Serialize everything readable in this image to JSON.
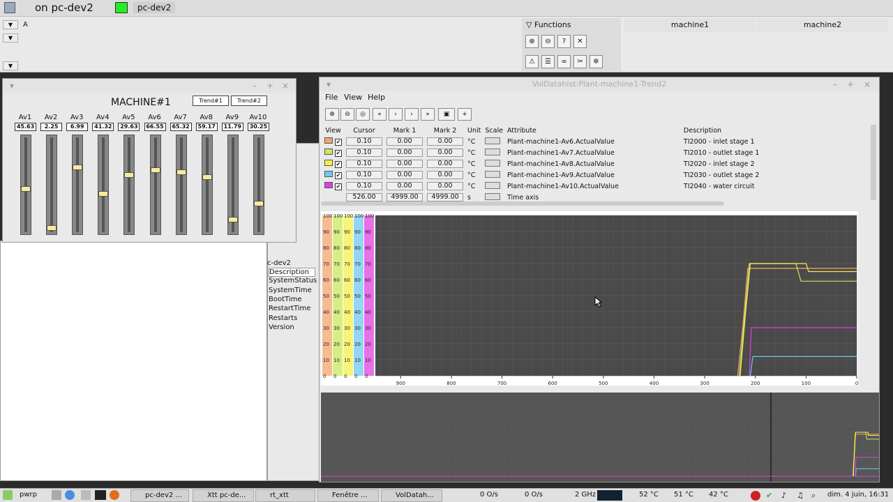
{
  "topbar": {
    "title": "on pc-dev2",
    "node": "pc-dev2"
  },
  "operator": {
    "drop_label": "A",
    "functions_label": "Functions",
    "tabs": [
      "machine1",
      "machine2"
    ],
    "node_color": "#22ee22"
  },
  "machine": {
    "title": "MACHINE#1",
    "trend_buttons": [
      "Trend#1",
      "Trend#2"
    ],
    "sliders": [
      {
        "label": "Av1",
        "value": "45.63",
        "level": 0.46
      },
      {
        "label": "Av2",
        "value": "2.25",
        "level": 0.02
      },
      {
        "label": "Av3",
        "value": "6.99",
        "level": 0.7
      },
      {
        "label": "Av4",
        "value": "41.32",
        "level": 0.41
      },
      {
        "label": "Av5",
        "value": "29.63",
        "level": 0.62
      },
      {
        "label": "Av6",
        "value": "66.55",
        "level": 0.67
      },
      {
        "label": "Av7",
        "value": "65.32",
        "level": 0.65
      },
      {
        "label": "Av8",
        "value": "59.17",
        "level": 0.59
      },
      {
        "label": "Av9",
        "value": "11.79",
        "level": 0.12
      },
      {
        "label": "Av10",
        "value": "30.25",
        "level": 0.3
      }
    ],
    "knob_color": "#f7eb9e"
  },
  "xtt": {
    "node": "c-dev2",
    "items": [
      "Description",
      "SystemStatus",
      "SystemTime",
      "BootTime",
      "RestartTime",
      "Restarts",
      "Version"
    ]
  },
  "trend": {
    "title": "VolDatahist:Plant-machine1-Trend2",
    "menu": [
      "File",
      "View",
      "Help"
    ],
    "headers": [
      "View",
      "Cursor",
      "Mark 1",
      "Mark 2",
      "Unit",
      "Scale",
      "Attribute",
      "Description"
    ],
    "rows": [
      {
        "color": "#f4a46e",
        "cursor": "0.10",
        "mark1": "0.00",
        "mark2": "0.00",
        "unit": "°C",
        "attribute": "Plant-machine1-Av6.ActualValue",
        "description": "TI2000 - inlet stage 1"
      },
      {
        "color": "#c8e85e",
        "cursor": "0.10",
        "mark1": "0.00",
        "mark2": "0.00",
        "unit": "°C",
        "attribute": "Plant-machine1-Av7.ActualValue",
        "description": "TI2010 - outlet stage 1"
      },
      {
        "color": "#f5f04a",
        "cursor": "0.10",
        "mark1": "0.00",
        "mark2": "0.00",
        "unit": "°C",
        "attribute": "Plant-machine1-Av8.ActualValue",
        "description": "TI2020 - inlet stage 2"
      },
      {
        "color": "#6ec8f0",
        "cursor": "0.10",
        "mark1": "0.00",
        "mark2": "0.00",
        "unit": "°C",
        "attribute": "Plant-machine1-Av9.ActualValue",
        "description": "TI2030 - outlet stage 2"
      },
      {
        "color": "#e040e0",
        "cursor": "0.10",
        "mark1": "0.00",
        "mark2": "0.00",
        "unit": "°C",
        "attribute": "Plant-machine1-Av10.ActualValue",
        "description": "TI2040 - water circuit"
      }
    ],
    "time_row": {
      "cursor": "526.00",
      "mark1": "4999.00",
      "mark2": "4999.00",
      "unit": "s",
      "attribute": "Time axis"
    }
  },
  "chart_data": {
    "type": "line",
    "x_ticks": [
      900,
      800,
      700,
      600,
      500,
      400,
      300,
      200,
      100,
      0
    ],
    "y_ticks": [
      0,
      10,
      20,
      30,
      40,
      50,
      60,
      70,
      80,
      90,
      100
    ],
    "xlim": [
      950,
      0
    ],
    "ylim": [
      0,
      100
    ],
    "grid": true,
    "series": [
      {
        "color": "#f4a46e",
        "x": [
          235,
          225,
          215,
          200,
          100,
          0
        ],
        "y": [
          0,
          30,
          67,
          67,
          67,
          67
        ]
      },
      {
        "color": "#c8e85e",
        "x": [
          232,
          222,
          212,
          120,
          110,
          0
        ],
        "y": [
          0,
          35,
          70,
          70,
          59,
          59
        ]
      },
      {
        "color": "#f5f04a",
        "x": [
          230,
          220,
          210,
          100,
          95,
          0
        ],
        "y": [
          0,
          37,
          70,
          70,
          65,
          65
        ]
      },
      {
        "color": "#6ec8f0",
        "x": [
          210,
          205,
          200,
          0
        ],
        "y": [
          0,
          12,
          12,
          12
        ]
      },
      {
        "color": "#e040e0",
        "x": [
          212,
          208,
          200,
          0
        ],
        "y": [
          0,
          30,
          30,
          30
        ]
      }
    ]
  },
  "taskbar": {
    "start": "pwrp",
    "tasks": [
      "pc-dev2 ...",
      "Xtt pc-de...",
      "rt_xtt",
      "Fenêtre ...",
      "VolDatah..."
    ],
    "net1": "0 O/s",
    "net2": "0 O/s",
    "cpu": "2 GHz",
    "temps": [
      "52 °C",
      "51 °C",
      "42 °C"
    ],
    "clock": "dim. 4 juin, 16:31"
  }
}
